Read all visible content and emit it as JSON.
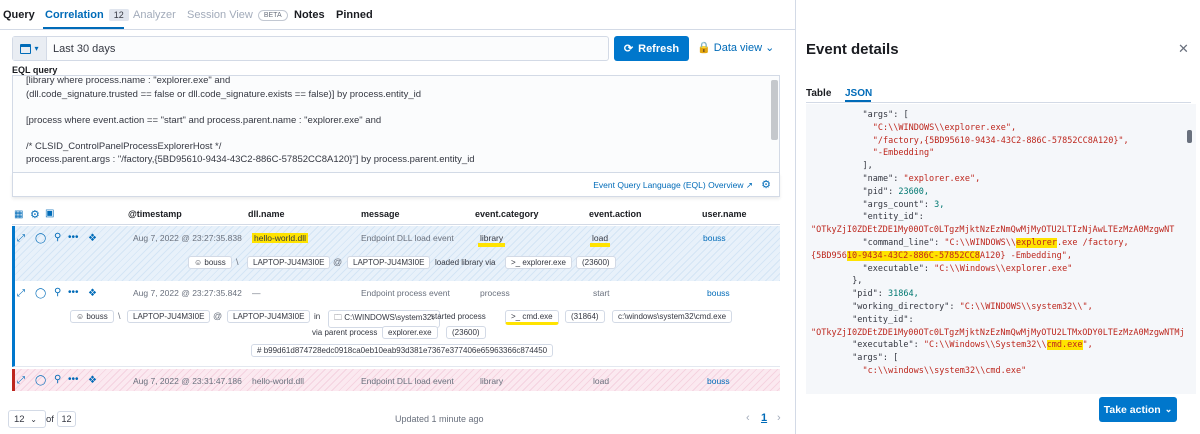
{
  "top_tabs": {
    "query": "Query",
    "correlation": "Correlation",
    "correlation_count": "12",
    "analyzer": "Analyzer",
    "session_view": "Session View",
    "beta": "BETA",
    "notes": "Notes",
    "pinned": "Pinned"
  },
  "query_bar": {
    "date_range": "Last 30 days",
    "refresh": "Refresh",
    "data_view": "Data view",
    "eql_label": "EQL query",
    "lines": [
      "[library where process.name : \"explorer.exe\" and",
      "(dll.code_signature.trusted == false or dll.code_signature.exists == false)] by process.entity_id",
      "",
      "[process where event.action == \"start\" and process.parent.name : \"explorer.exe\" and",
      "",
      "/* CLSID_ControlPanelProcessExplorerHost */",
      "process.parent.args : \"/factory,{5BD95610-9434-43C2-886C-57852CC8A120}\"] by process.parent.entity_id"
    ],
    "eql_overview_link": "Event Query Language (EQL) Overview"
  },
  "table": {
    "columns": [
      "@timestamp",
      "dll.name",
      "message",
      "event.category",
      "event.action",
      "user.name"
    ],
    "rows": [
      {
        "timestamp": "Aug 7, 2022 @ 23:27:35.838",
        "dll_name": "hello-world.dll",
        "message": "Endpoint DLL load event",
        "category": "library",
        "action": "load",
        "user": "bouss",
        "renderer": {
          "user": "bouss",
          "sep1": "\\",
          "host1": "LAPTOP-JU4M3I0E",
          "at": "@",
          "host2": "LAPTOP-JU4M3I0E",
          "text": "loaded library via",
          "process": "explorer.exe",
          "pid": "(23600)"
        }
      },
      {
        "timestamp": "Aug 7, 2022 @ 23:27:35.842",
        "dll_name": "—",
        "message": "Endpoint process event",
        "category": "process",
        "action": "start",
        "user": "bouss",
        "renderer": {
          "user": "bouss",
          "sep1": "\\",
          "host1": "LAPTOP-JU4M3I0E",
          "at": "@",
          "host2": "LAPTOP-JU4M3I0E",
          "in": "in",
          "dir": "C:\\WINDOWS\\system32\\",
          "started": "started process",
          "process": "cmd.exe",
          "pid": "(31864)",
          "path": "c:\\windows\\system32\\cmd.exe",
          "via": "via parent process",
          "parent": "explorer.exe",
          "parent_pid": "(23600)",
          "hash": "b99d61d874728edc0918ca0eb10eab93d381e7367e377406e65963366c874450"
        }
      },
      {
        "timestamp": "Aug 7, 2022 @ 23:31:47.186",
        "dll_name": "hello-world.dll",
        "message": "Endpoint DLL load event",
        "category": "library",
        "action": "load",
        "user": "bouss"
      }
    ]
  },
  "pagination": {
    "per_page": "12",
    "of": "of",
    "total": "12",
    "updated": "Updated 1 minute ago",
    "current_page": "1"
  },
  "flyout": {
    "title": "Event details",
    "tab_table": "Table",
    "tab_json": "JSON",
    "take_action": "Take action",
    "json_lines": [
      {
        "indent": 5,
        "parts": [
          {
            "t": "k",
            "v": "\"args\": ["
          }
        ]
      },
      {
        "indent": 6,
        "parts": [
          {
            "t": "s",
            "v": "\"C:\\\\WINDOWS\\\\explorer.exe\","
          }
        ]
      },
      {
        "indent": 6,
        "parts": [
          {
            "t": "s",
            "v": "\"/factory,{5BD95610-9434-43C2-886C-57852CC8A120}\","
          }
        ]
      },
      {
        "indent": 6,
        "parts": [
          {
            "t": "s",
            "v": "\"-Embedding\""
          }
        ]
      },
      {
        "indent": 5,
        "parts": [
          {
            "t": "k",
            "v": "],"
          }
        ]
      },
      {
        "indent": 5,
        "parts": [
          {
            "t": "k",
            "v": "\"name\": "
          },
          {
            "t": "s",
            "v": "\"explorer.exe\","
          }
        ]
      },
      {
        "indent": 5,
        "parts": [
          {
            "t": "k",
            "v": "\"pid\": "
          },
          {
            "t": "n",
            "v": "23600,"
          }
        ]
      },
      {
        "indent": 5,
        "parts": [
          {
            "t": "k",
            "v": "\"args_count\": "
          },
          {
            "t": "n",
            "v": "3,"
          }
        ]
      },
      {
        "indent": 5,
        "parts": [
          {
            "t": "k",
            "v": "\"entity_id\":"
          }
        ]
      },
      {
        "indent": 0,
        "parts": [
          {
            "t": "s",
            "v": "\"OTkyZjI0ZDEtZDE1My00OTc0LTgzMjktNzEzNmQwMjMyOTU2LTIzNjAwLTEzMzA0MzgwNT"
          }
        ]
      },
      {
        "indent": 5,
        "parts": [
          {
            "t": "k",
            "v": "\"command_line\": "
          },
          {
            "t": "s",
            "v": "\"C:\\\\WINDOWS\\\\"
          },
          {
            "t": "sh",
            "v": "explorer"
          },
          {
            "t": "s",
            "v": ".exe /factory,"
          }
        ]
      },
      {
        "indent": 0,
        "parts": [
          {
            "t": "s",
            "v": "{5BD956"
          },
          {
            "t": "sh",
            "v": "10-9434-43C2-886C-57852CC8"
          },
          {
            "t": "s",
            "v": "A120} -Embedding\","
          }
        ]
      },
      {
        "indent": 5,
        "parts": [
          {
            "t": "k",
            "v": "\"executable\": "
          },
          {
            "t": "s",
            "v": "\"C:\\\\Windows\\\\explorer.exe\""
          }
        ]
      },
      {
        "indent": 4,
        "parts": [
          {
            "t": "k",
            "v": "},"
          }
        ]
      },
      {
        "indent": 4,
        "parts": [
          {
            "t": "k",
            "v": "\"pid\": "
          },
          {
            "t": "n",
            "v": "31864,"
          }
        ]
      },
      {
        "indent": 4,
        "parts": [
          {
            "t": "k",
            "v": "\"working_directory\": "
          },
          {
            "t": "s",
            "v": "\"C:\\\\WINDOWS\\\\system32\\\\\","
          }
        ]
      },
      {
        "indent": 4,
        "parts": [
          {
            "t": "k",
            "v": "\"entity_id\":"
          }
        ]
      },
      {
        "indent": 0,
        "parts": [
          {
            "t": "s",
            "v": "\"OTkyZjI0ZDEtZDE1My00OTc0LTgzMjktNzEzNmQwMjMyOTU2LTMxODY0LTEzMzA0MzgwNTMj"
          }
        ]
      },
      {
        "indent": 4,
        "parts": [
          {
            "t": "k",
            "v": "\"executable\": "
          },
          {
            "t": "s",
            "v": "\"C:\\\\Windows\\\\System32\\\\"
          },
          {
            "t": "sh",
            "v": "cmd.exe"
          },
          {
            "t": "s",
            "v": "\","
          }
        ]
      },
      {
        "indent": 4,
        "parts": [
          {
            "t": "k",
            "v": "\"args\": ["
          }
        ]
      },
      {
        "indent": 5,
        "parts": [
          {
            "t": "s",
            "v": "\"c:\\\\windows\\\\system32\\\\cmd.exe\""
          }
        ]
      }
    ]
  },
  "colors": {
    "accent": "#0077cc",
    "link": "#006bb8",
    "highlight": "#ffe300",
    "json_string": "#bd271e",
    "json_number": "#007871",
    "row_danger": "#bd271e"
  }
}
